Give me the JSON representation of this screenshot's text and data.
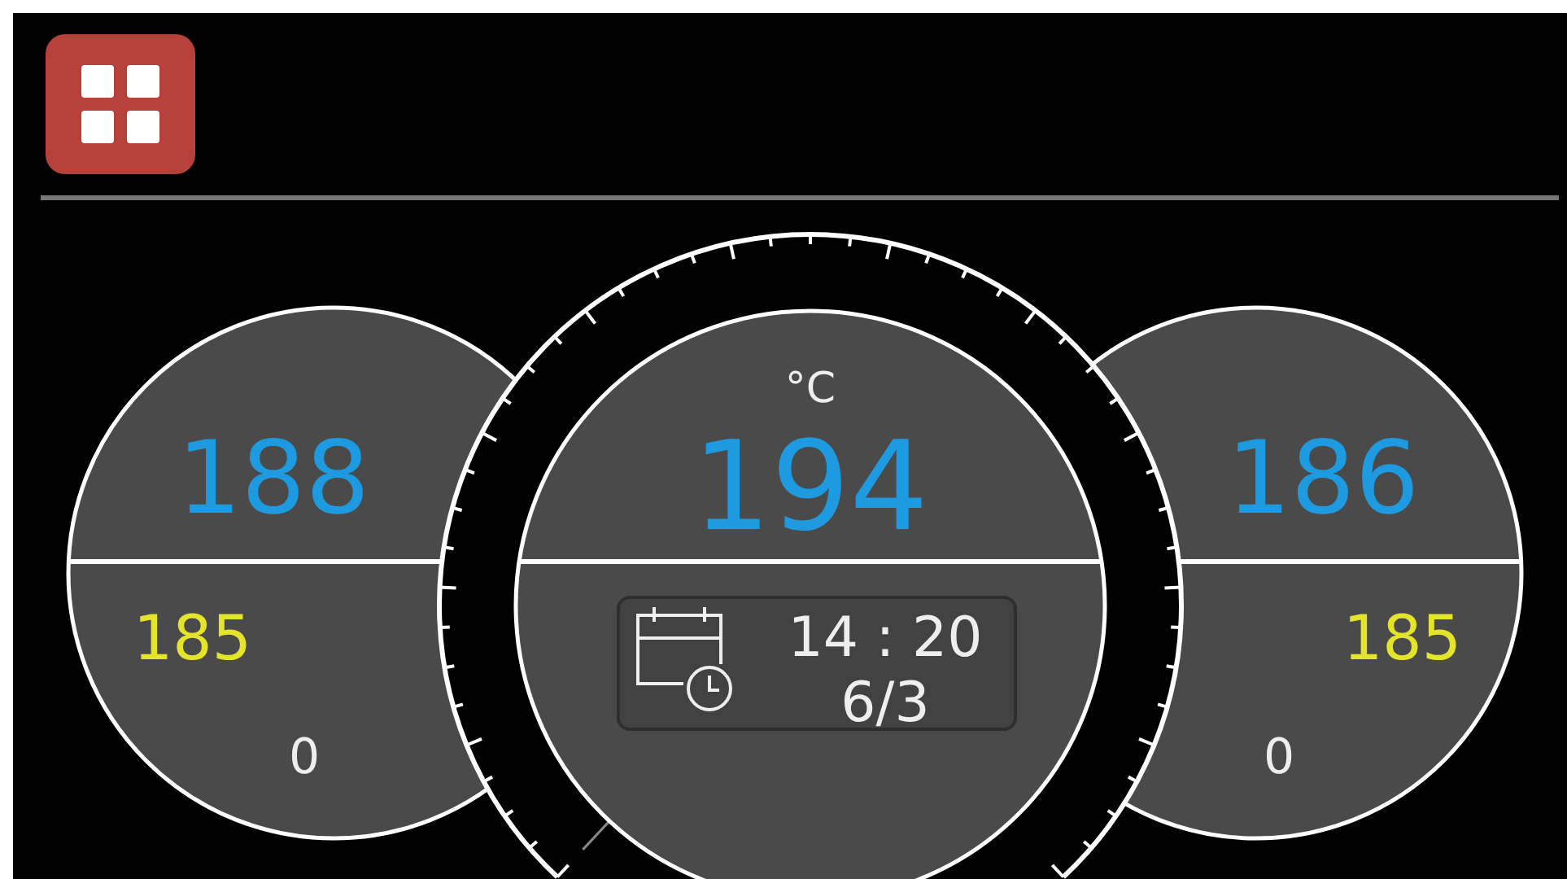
{
  "menu_button": {
    "kind": "grid"
  },
  "side_gauges": [
    {
      "value": "188",
      "setpoint": "185",
      "output": "0"
    },
    {
      "value": "186",
      "setpoint": "185",
      "output": "0"
    }
  ],
  "center_gauge": {
    "unit": "°C",
    "value": "194",
    "time": "14 : 20",
    "date": "6/3"
  }
}
